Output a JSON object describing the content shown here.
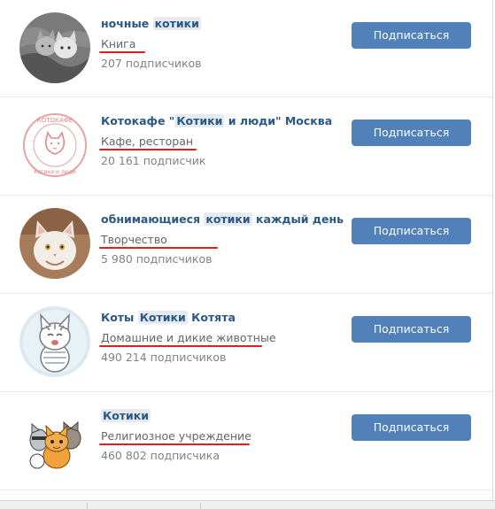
{
  "subscribe_label": "Подписаться",
  "colors": {
    "link": "#2a5885",
    "button": "#5181b8",
    "highlight": "#e5ebf1",
    "underline": "#e02020"
  },
  "groups": [
    {
      "title_parts": [
        "ночные ",
        "котики",
        ""
      ],
      "category": "Книга",
      "subscribers": "207 подписчиков",
      "avatar": "cats-on-blanket-photo"
    },
    {
      "title_parts": [
        "Котокафе \"",
        "Котики",
        " и люди\" Москва"
      ],
      "category": "Кафе, ресторан",
      "subscribers": "20 161 подписчик",
      "avatar": "cat-cafe-logo",
      "logo_top_text": "КОТОКАФЕ",
      "logo_bottom_text": "Котики и люди"
    },
    {
      "title_parts": [
        "обнимающиеся ",
        "котики",
        " каждый день"
      ],
      "category": "Творчество",
      "subscribers": "5 980 подписчиков",
      "avatar": "white-cat-photo"
    },
    {
      "title_parts": [
        "Коты ",
        "Котики",
        " Котята"
      ],
      "category": "Домашние и дикие животные",
      "subscribers": "490 214 подписчиков",
      "avatar": "cartoon-striped-cat"
    },
    {
      "title_parts": [
        "",
        "Котики",
        ""
      ],
      "category": "Религиозное учреждение",
      "subscribers": "460 802 подписчика",
      "avatar": "cartoon-cats-group"
    }
  ]
}
